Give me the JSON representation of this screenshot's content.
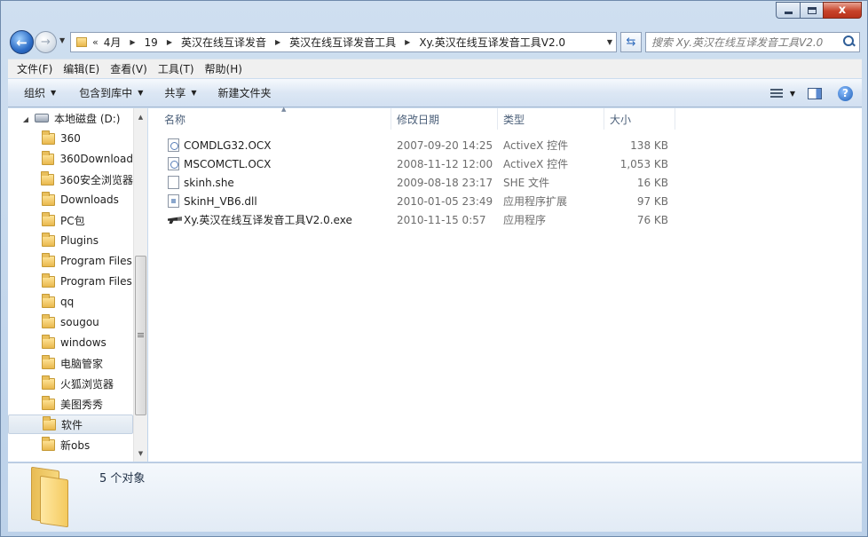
{
  "nav": {
    "back_glyph": "←",
    "forward_glyph": "→",
    "overflow": "«",
    "breadcrumb": [
      "4月",
      "19",
      "英汉在线互译发音",
      "英汉在线互译发音工具",
      "Xy.英汉在线互译发音工具V2.0"
    ],
    "search_placeholder": "搜索 Xy.英汉在线互译发音工具V2.0"
  },
  "caption": {
    "close_glyph": "x"
  },
  "menu": [
    "文件(F)",
    "编辑(E)",
    "查看(V)",
    "工具(T)",
    "帮助(H)"
  ],
  "commands": {
    "organize": "组织",
    "include_library": "包含到库中",
    "share": "共享",
    "new_folder": "新建文件夹"
  },
  "help_glyph": "?",
  "tree": [
    {
      "label": "本地磁盘 (D:)",
      "kind": "drive"
    },
    {
      "label": "360",
      "kind": "folder"
    },
    {
      "label": "360Download",
      "kind": "folder"
    },
    {
      "label": "360安全浏览器",
      "kind": "folder"
    },
    {
      "label": "Downloads",
      "kind": "folder"
    },
    {
      "label": "PC包",
      "kind": "folder"
    },
    {
      "label": "Plugins",
      "kind": "folder"
    },
    {
      "label": "Program Files",
      "kind": "folder"
    },
    {
      "label": "Program Files",
      "kind": "folder"
    },
    {
      "label": "qq",
      "kind": "folder"
    },
    {
      "label": "sougou",
      "kind": "folder"
    },
    {
      "label": "windows",
      "kind": "folder"
    },
    {
      "label": "电脑管家",
      "kind": "folder"
    },
    {
      "label": "火狐浏览器",
      "kind": "folder"
    },
    {
      "label": "美图秀秀",
      "kind": "folder"
    },
    {
      "label": "软件",
      "kind": "folder",
      "selected": true
    },
    {
      "label": "新obs",
      "kind": "folder"
    }
  ],
  "columns": {
    "name": "名称",
    "date": "修改日期",
    "type": "类型",
    "size": "大小"
  },
  "files": [
    {
      "name": "COMDLG32.OCX",
      "date": "2007-09-20 14:25",
      "type": "ActiveX 控件",
      "size": "138 KB",
      "icon": "ocx"
    },
    {
      "name": "MSCOMCTL.OCX",
      "date": "2008-11-12 12:00",
      "type": "ActiveX 控件",
      "size": "1,053 KB",
      "icon": "ocx"
    },
    {
      "name": "skinh.she",
      "date": "2009-08-18 23:17",
      "type": "SHE 文件",
      "size": "16 KB",
      "icon": "file"
    },
    {
      "name": "SkinH_VB6.dll",
      "date": "2010-01-05 23:49",
      "type": "应用程序扩展",
      "size": "97 KB",
      "icon": "dll"
    },
    {
      "name": "Xy.英汉在线互译发音工具V2.0.exe",
      "date": "2010-11-15 0:57",
      "type": "应用程序",
      "size": "76 KB",
      "icon": "exe"
    }
  ],
  "details": {
    "count": "5 个对象"
  }
}
